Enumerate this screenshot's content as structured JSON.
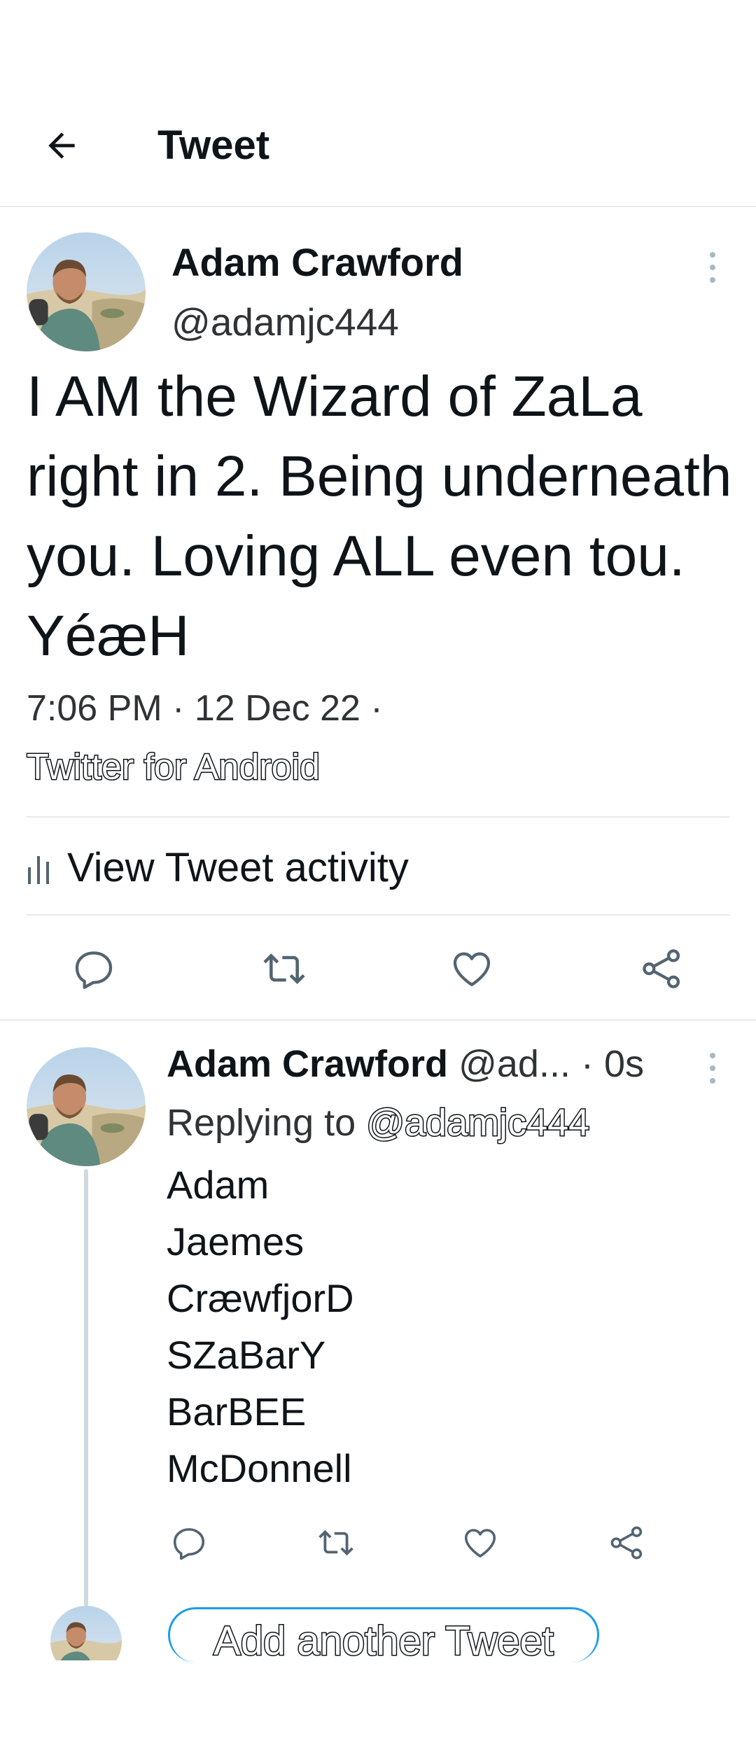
{
  "header": {
    "title": "Tweet",
    "back_icon": "arrow-left-icon"
  },
  "tweet": {
    "author_name": "Adam Crawford",
    "author_handle": "@adamjc444",
    "text": "I AM the Wizard of ZaLa right in 2. Being underneath you. Loving ALL even tou. YéæH",
    "meta": "7:06 PM · 12 Dec 22 ·",
    "source": "Twitter for Android",
    "activity_label": "View Tweet activity",
    "actions": [
      "reply-icon",
      "retweet-icon",
      "like-icon",
      "share-icon"
    ]
  },
  "reply": {
    "author_name": "Adam Crawford",
    "author_handle": "@ad...",
    "time": "· 0s",
    "replying_prefix": "Replying to",
    "replying_to": "@adamjc444",
    "lines": [
      "Adam",
      "Jaemes",
      "CræwfjorD",
      "SZaBarY",
      "BarBEE",
      "McDonnell"
    ]
  },
  "compose": {
    "add_tweet_label": "Add another Tweet"
  },
  "colors": {
    "accent": "#1d9bf0",
    "text": "#0f1419",
    "secondary_text": "#536471",
    "divider": "#e6e9ec",
    "thread_line": "#cfd9de"
  }
}
